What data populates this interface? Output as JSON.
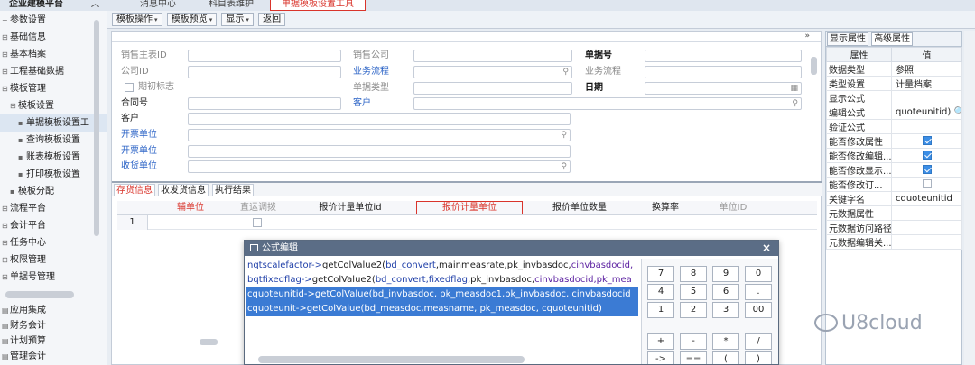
{
  "sidebar": {
    "header": "企业建模平台",
    "items": [
      {
        "label": "参数设置",
        "toggle": "+",
        "indent": 0
      },
      {
        "label": "基础信息",
        "toggle": "⊞",
        "indent": 0
      },
      {
        "label": "基本档案",
        "toggle": "⊞",
        "indent": 0
      },
      {
        "label": "工程基础数据",
        "toggle": "⊞",
        "indent": 0
      },
      {
        "label": "模板管理",
        "toggle": "⊟",
        "indent": 0
      },
      {
        "label": "模板设置",
        "toggle": "⊟",
        "indent": 1
      },
      {
        "label": "单据模板设置工",
        "toggle": "▪",
        "indent": 2,
        "selected": true
      },
      {
        "label": "查询模板设置",
        "toggle": "▪",
        "indent": 2
      },
      {
        "label": "账表模板设置",
        "toggle": "▪",
        "indent": 2
      },
      {
        "label": "打印模板设置",
        "toggle": "▪",
        "indent": 2
      },
      {
        "label": "模板分配",
        "toggle": "▪",
        "indent": 1
      },
      {
        "label": "流程平台",
        "toggle": "⊞",
        "indent": 0
      },
      {
        "label": "会计平台",
        "toggle": "⊞",
        "indent": 0
      },
      {
        "label": "任务中心",
        "toggle": "⊞",
        "indent": 0
      },
      {
        "label": "权限管理",
        "toggle": "⊞",
        "indent": 0
      },
      {
        "label": "单据号管理",
        "toggle": "⊞",
        "indent": 0
      }
    ],
    "bottom": [
      "应用集成",
      "财务会计",
      "计划预算",
      "管理会计"
    ]
  },
  "tabs": [
    "消息中心",
    "科目表维护",
    "单据模板设置工具"
  ],
  "toolbar": {
    "template_ops": "模板操作",
    "template_preview": "模板预览",
    "display": "显示",
    "back": "返回"
  },
  "form": {
    "labels": {
      "sales_master_id": "销售主表ID",
      "sales_company": "销售公司",
      "doc_no": "单据号",
      "company_id": "公司ID",
      "biz_flow_blue": "业务流程",
      "biz_flow": "业务流程",
      "initial_flag": "期初标志",
      "doc_type": "单据类型",
      "date": "日期",
      "contract_no": "合同号",
      "customer_blue": "客户",
      "customer": "客户",
      "invoice_unit": "开票单位",
      "invoice_unit2": "开票单位",
      "receiving_unit": "收货单位"
    }
  },
  "subtabs": [
    "存货信息",
    "收发货信息",
    "执行结果"
  ],
  "grid": {
    "headers": [
      "辅单位",
      "直运调拨",
      "报价计量单位id",
      "报价计量单位",
      "报价单位数量",
      "换算率",
      "单位ID"
    ],
    "row_number": "1"
  },
  "props": {
    "tabs": [
      "显示属性",
      "高级属性"
    ],
    "col_attr": "属性",
    "col_val": "值",
    "rows": [
      {
        "name": "数据类型",
        "value": "参照"
      },
      {
        "name": "类型设置",
        "value": "计量档案"
      },
      {
        "name": "显示公式",
        "value": ""
      },
      {
        "name": "编辑公式",
        "value": "quoteunitid) 🔍"
      },
      {
        "name": "验证公式",
        "value": ""
      },
      {
        "name": "能否修改属性",
        "check": true
      },
      {
        "name": "能否修改编辑...",
        "check": true
      },
      {
        "name": "能否修改显示...",
        "check": true
      },
      {
        "name": "能否修改订...",
        "check": false
      },
      {
        "name": "关键字名",
        "value": "cquoteunitid"
      },
      {
        "name": "元数据属性",
        "value": ""
      },
      {
        "name": "元数据访问路径",
        "value": ""
      },
      {
        "name": "元数据编辑关...",
        "value": ""
      }
    ]
  },
  "dialog": {
    "title": "公式编辑",
    "close": "×",
    "lines": [
      {
        "a": "nqtscalefactor->",
        "b": "getColValue2(",
        "c": "bd_convert",
        "d": ",mainmeasrate,pk_invbasdoc,",
        "e": "cinvbasdocid,"
      },
      {
        "a": "bqtfixedflag->",
        "b": "getColValue2(",
        "c": "bd_convert,fixedflag",
        "d": ",pk_invbasdoc,",
        "e": "cinvbasdocid,pk_mea"
      },
      {
        "a": "cquoteunitid->",
        "b": "getColValue(",
        "c": "bd_invbasdoc, pk_measdoc1,pk_invbasdoc, cinvbasdocid",
        "d": "",
        "e": ""
      },
      {
        "a": "cquoteunit->",
        "b": "getColValue(",
        "c": "bd_measdoc,measname, pk_measdoc, cquoteunitid)",
        "d": "",
        "e": ""
      }
    ],
    "keys": [
      "7",
      "8",
      "9",
      "0",
      "4",
      "5",
      "6",
      ".",
      "1",
      "2",
      "3",
      "00",
      "+",
      "-",
      "*",
      "/",
      "->",
      "==",
      "(",
      ")"
    ]
  },
  "watermark": "U8cloud"
}
